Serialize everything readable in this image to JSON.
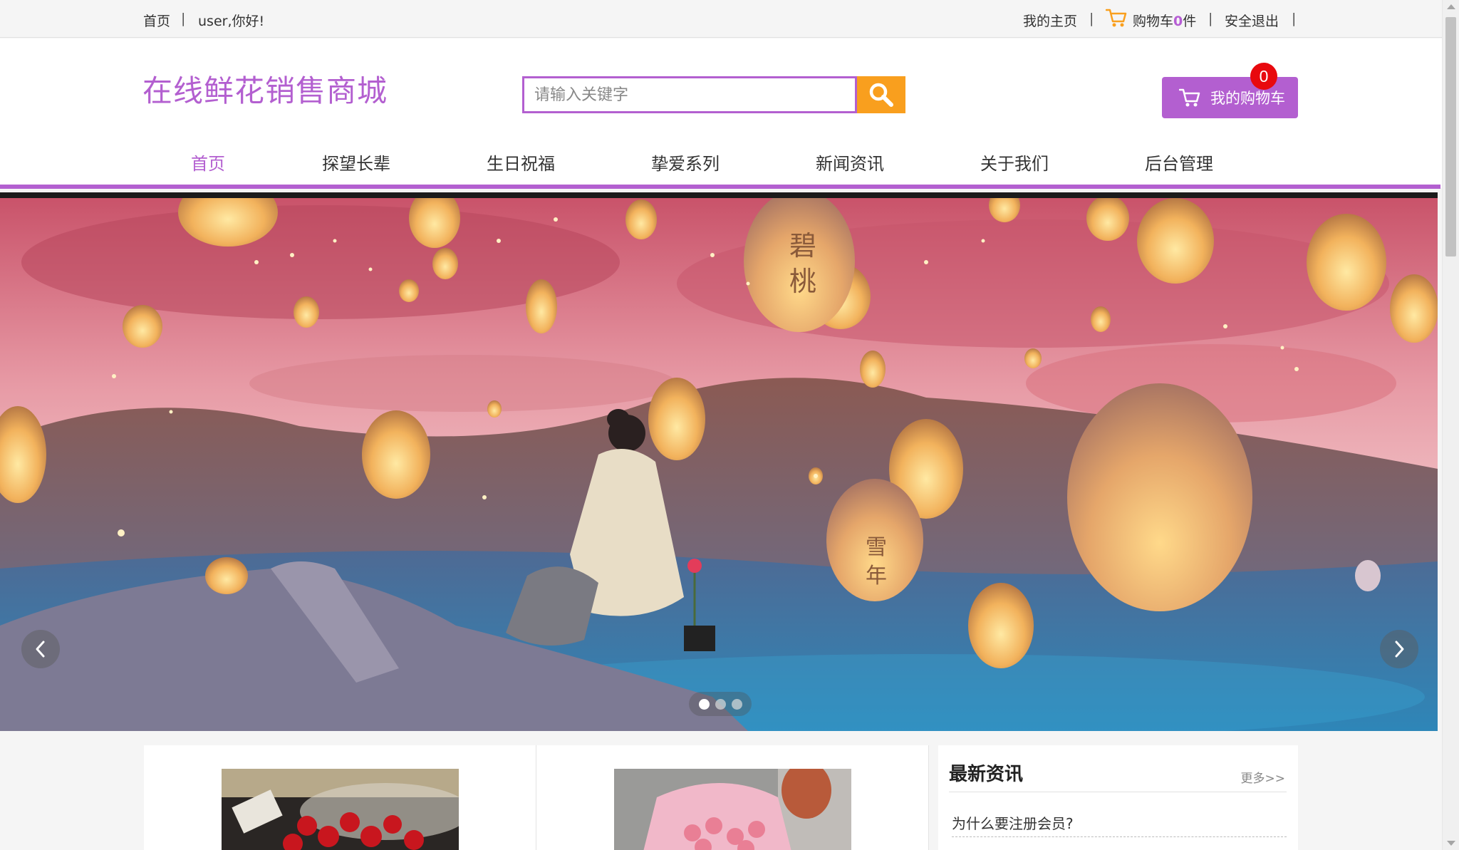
{
  "topbar": {
    "home": "首页",
    "separator": "|",
    "greeting": "user,你好!",
    "my_home": "我的主页",
    "cart_prefix": "购物车",
    "cart_count": "0",
    "cart_suffix": "件",
    "logout": "安全退出"
  },
  "header": {
    "logo": "在线鲜花销售商城",
    "search_placeholder": "请输入关键字",
    "search_icon": "search-icon",
    "cart_button": "我的购物车",
    "cart_badge": "0"
  },
  "nav": {
    "items": [
      "首页",
      "探望长辈",
      "生日祝福",
      "挚爱系列",
      "新闻资讯",
      "关于我们",
      "后台管理"
    ],
    "active_index": 0
  },
  "banner": {
    "slide_count": 3,
    "active_slide": 1,
    "lantern_texts": [
      "碧",
      "桃",
      "雪",
      "年"
    ]
  },
  "news": {
    "title": "最新资讯",
    "more": "更多>>",
    "items": [
      "为什么要注册会员?"
    ]
  },
  "colors": {
    "accent": "#b35fd0",
    "search_button": "#f99f1e",
    "badge": "#e8090e"
  }
}
